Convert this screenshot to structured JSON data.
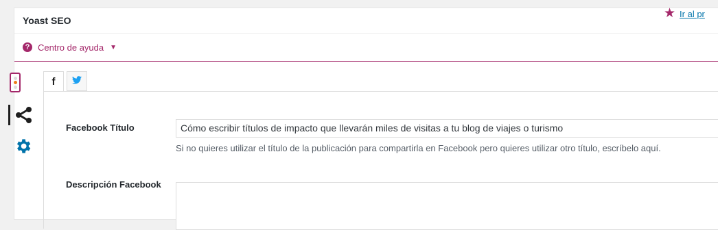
{
  "metabox": {
    "title": "Yoast SEO"
  },
  "helpbar": {
    "help_icon": "question-circle-icon",
    "help_label": "Centro de ayuda",
    "premium_icon": "star-icon",
    "premium_label": "Ir al pr"
  },
  "sidebar": {
    "items": [
      {
        "name": "seo-traffic-light-icon"
      },
      {
        "name": "share-icon",
        "active": true
      },
      {
        "name": "gear-icon"
      }
    ]
  },
  "tabs": [
    {
      "label": "f",
      "icon": "facebook-icon",
      "active": true
    },
    {
      "icon": "twitter-icon",
      "active": false
    }
  ],
  "facebook": {
    "title_label": "Facebook Título",
    "title_value": "Cómo escribir títulos de impacto que llevarán miles de visitas a tu blog de viajes o turismo",
    "title_hint": "Si no quieres utilizar el título de la publicación para compartirla en Facebook pero quieres utilizar otro título, escríbelo aquí.",
    "description_label": "Descripción Facebook",
    "description_value": ""
  },
  "colors": {
    "accent": "#a4286a",
    "link": "#0073aa",
    "twitter": "#1da1f2"
  }
}
